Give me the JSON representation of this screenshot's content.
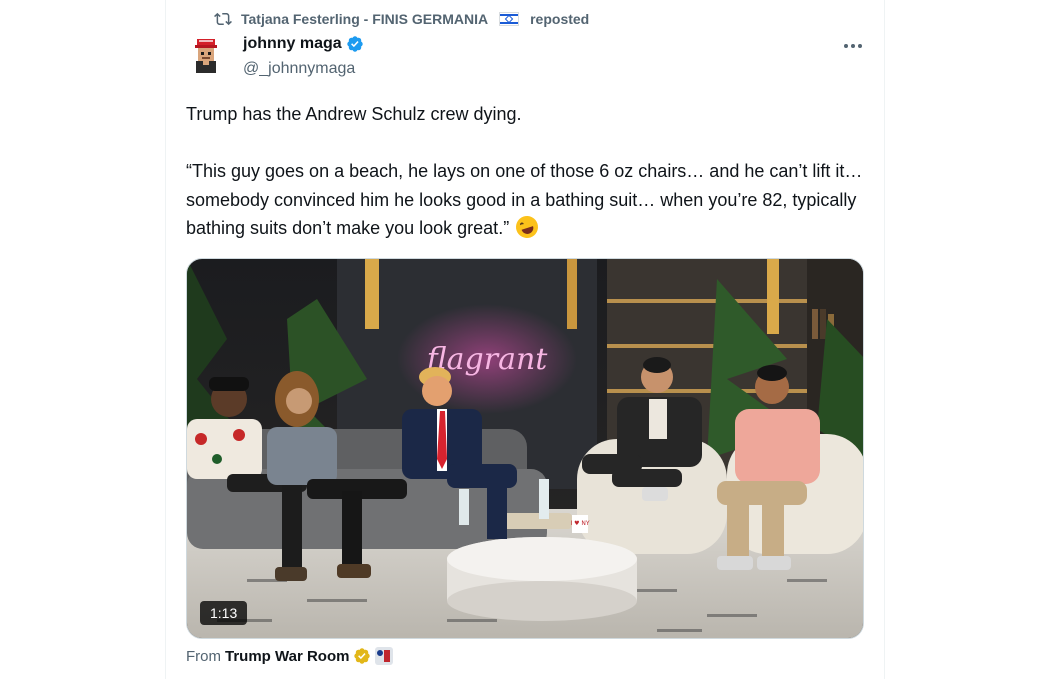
{
  "repost": {
    "user": "Tatjana Festerling - FINIS GERMANIA",
    "flag_icon": "israel-flag-icon",
    "label": "reposted"
  },
  "author": {
    "name": "johnny maga",
    "handle": "@_johnnymaga",
    "verified_color": "#1d9bf0"
  },
  "tweet": {
    "line1": "Trump has the Andrew Schulz crew dying.",
    "quote": "“This guy goes on a beach, he lays on one of those 6 oz chairs… and he can’t lift it… somebody convinced him he looks good in a bathing suit… when you’re 82, typically bathing suits don’t make you look great.”",
    "emoji": "rolling-on-floor-laughing-emoji"
  },
  "media": {
    "duration": "1:13",
    "sign_text": "flagrant",
    "mug_text": "I ♥ NY"
  },
  "source": {
    "prefix": "From",
    "name": "Trump War Room",
    "badge_color": "#e2b719"
  },
  "colors": {
    "text_primary": "#0f1419",
    "text_secondary": "#536471",
    "border": "#cfd9de"
  }
}
